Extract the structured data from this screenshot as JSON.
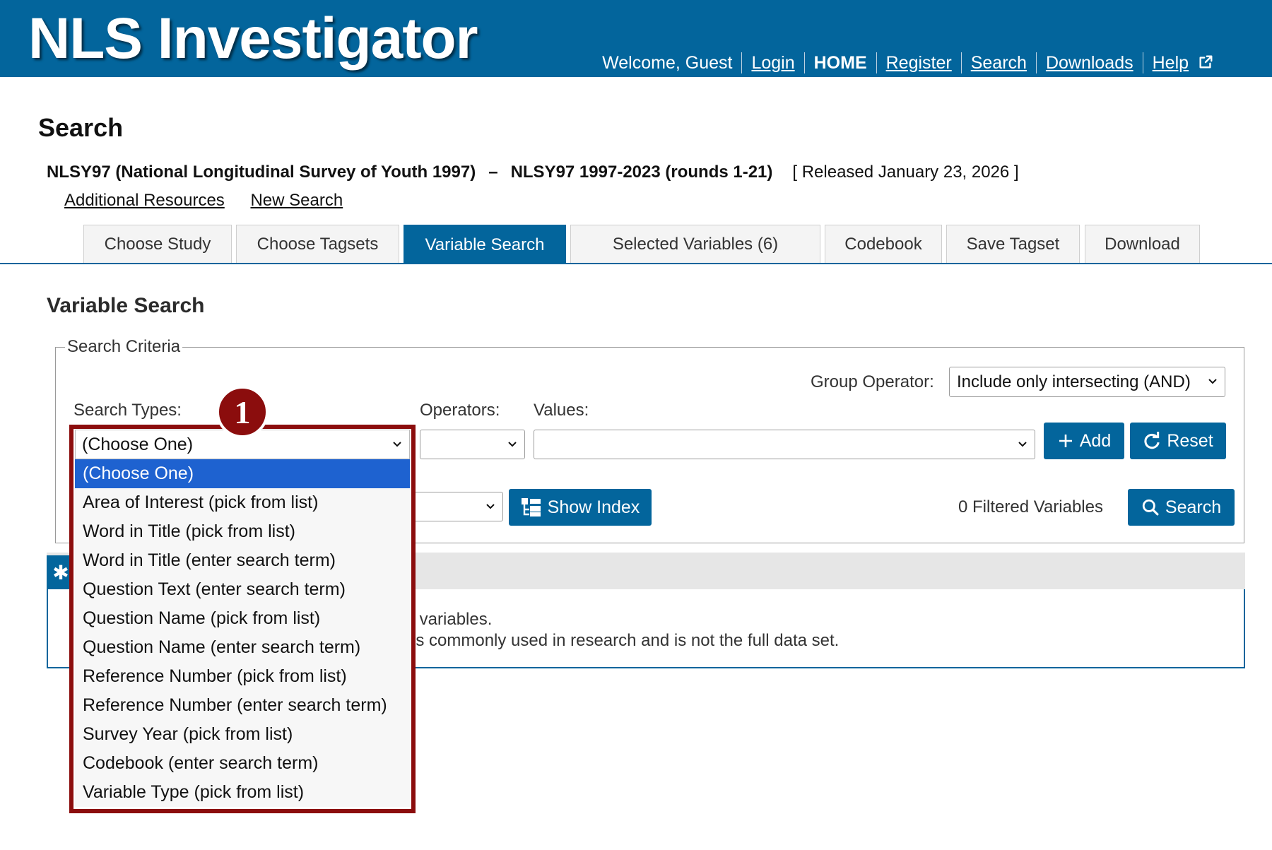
{
  "app": {
    "logo": "NLS Investigator"
  },
  "topnav": {
    "welcome": "Welcome, Guest",
    "login": "Login",
    "home": "HOME",
    "register": "Register",
    "search": "Search",
    "downloads": "Downloads",
    "help": "Help"
  },
  "page": {
    "title": "Search",
    "study_name": "NLSY97 (National Longitudinal Survey of Youth 1997)",
    "separator": "–",
    "study_rounds": "NLSY97 1997-2023 (rounds 1-21)",
    "released": "[ Released January 23, 2026 ]",
    "additional_resources": "Additional Resources",
    "new_search": "New Search"
  },
  "tabs": [
    {
      "label": "Choose Study",
      "active": false
    },
    {
      "label": "Choose Tagsets",
      "active": false
    },
    {
      "label": "Variable Search",
      "active": true
    },
    {
      "label": "Selected Variables (6)",
      "active": false
    },
    {
      "label": "Codebook",
      "active": false
    },
    {
      "label": "Save Tagset",
      "active": false
    },
    {
      "label": "Download",
      "active": false
    }
  ],
  "variable_search": {
    "title": "Variable Search",
    "criteria_legend": "Search Criteria",
    "group_operator_label": "Group Operator:",
    "group_operator_value": "Include only intersecting (AND)",
    "search_types_label": "Search Types:",
    "operators_label": "Operators:",
    "values_label": "Values:",
    "add_button": "Add",
    "reset_button": "Reset",
    "show_index_button": "Show Index",
    "filtered_count": "0 Filtered Variables",
    "search_button": "Search"
  },
  "info": {
    "line1_fragment": "y variables.",
    "line2_fragment": "es commonly used in research and is not the full data set."
  },
  "search_types_dropdown": {
    "selected": "(Choose One)",
    "options": [
      "(Choose One)",
      "Area of Interest (pick from list)",
      "Word in Title (pick from list)",
      "Word in Title (enter search term)",
      "Question Text (enter search term)",
      "Question Name (pick from list)",
      "Question Name (enter search term)",
      "Reference Number (pick from list)",
      "Reference Number (enter search term)",
      "Survey Year (pick from list)",
      "Codebook (enter search term)",
      "Variable Type (pick from list)"
    ],
    "highlighted_index": 0
  },
  "callout": {
    "number": "1"
  },
  "colors": {
    "brand_blue": "#03659c",
    "callout_red": "#8b0d0d",
    "option_highlight": "#1e62d0"
  }
}
